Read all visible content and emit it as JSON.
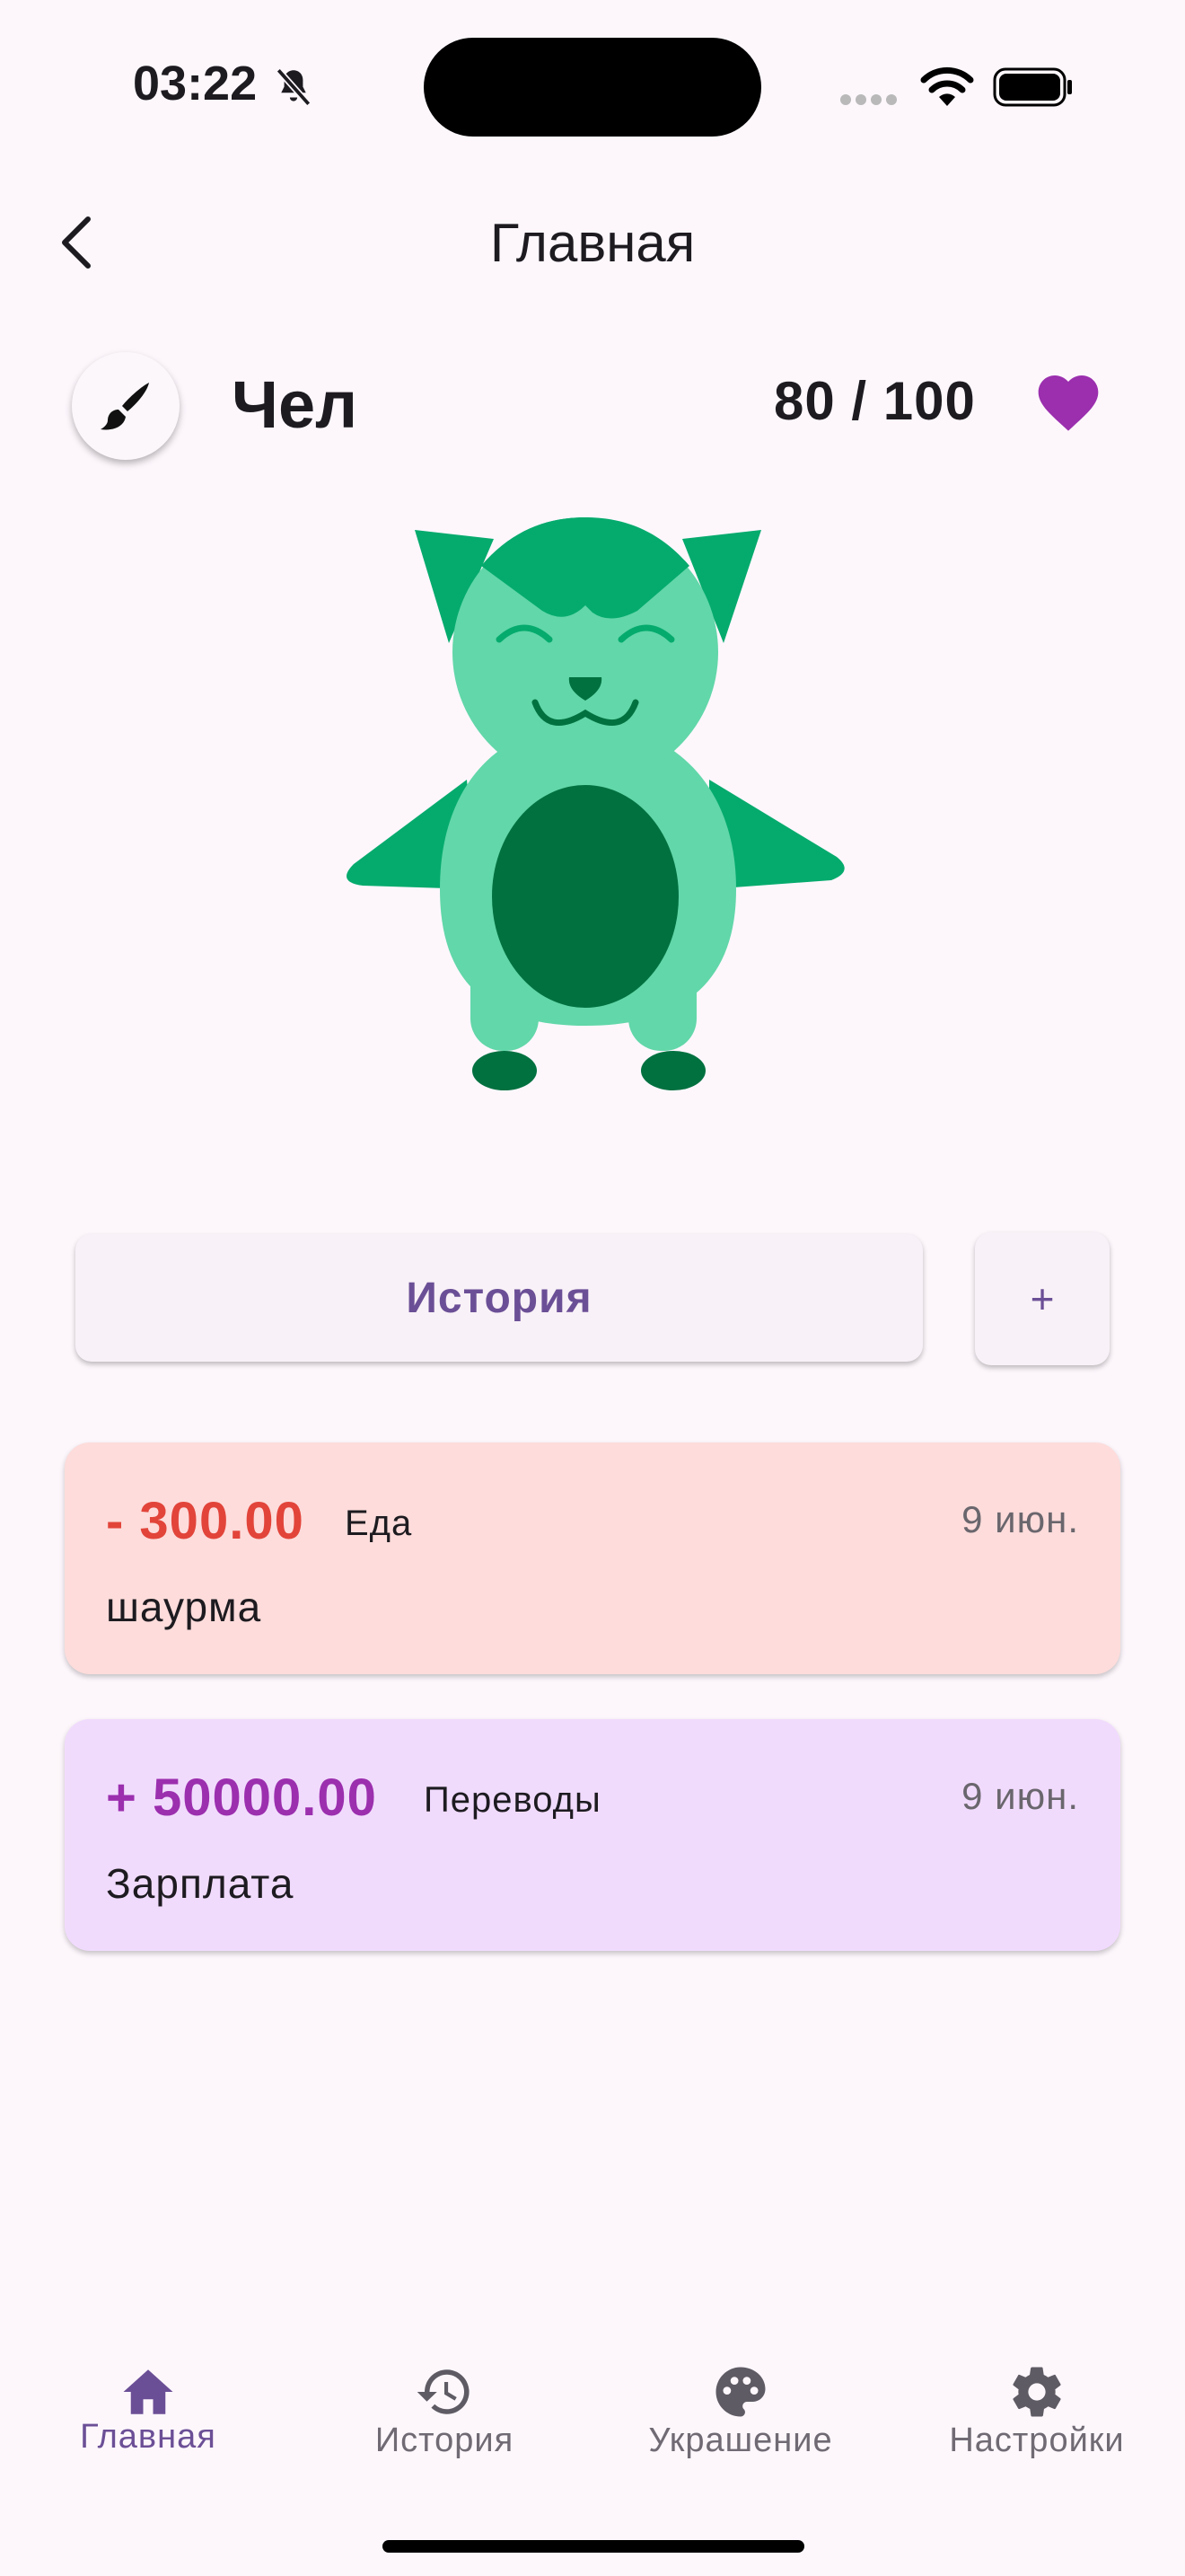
{
  "status_bar": {
    "time": "03:22"
  },
  "header": {
    "title": "Главная"
  },
  "profile": {
    "name": "Чел",
    "health": "80 / 100"
  },
  "actions": {
    "history_label": "История",
    "add_label": "+"
  },
  "transactions": [
    {
      "amount": "- 300.00",
      "category": "Еда",
      "date": "9 июн.",
      "description": "шаурма",
      "type": "expense",
      "amount_color": "#e2443a",
      "card_color": "#fddcdb"
    },
    {
      "amount": "+ 50000.00",
      "category": "Переводы",
      "date": "9 июн.",
      "description": "Зарплата",
      "type": "income",
      "amount_color": "#9b2fae",
      "card_color": "#f1dbfd"
    }
  ],
  "bottom_nav": {
    "items": [
      {
        "label": "Главная",
        "icon": "home-icon",
        "active": true
      },
      {
        "label": "История",
        "icon": "history-icon",
        "active": false
      },
      {
        "label": "Украшение",
        "icon": "palette-icon",
        "active": false
      },
      {
        "label": "Настройки",
        "icon": "gear-icon",
        "active": false
      }
    ]
  },
  "colors": {
    "accent": "#6b4f96",
    "heart": "#9b2fae",
    "background": "#fdf7fc",
    "pet_light": "#62d7a9",
    "pet_mid": "#05ab6d",
    "pet_dark": "#017140"
  }
}
